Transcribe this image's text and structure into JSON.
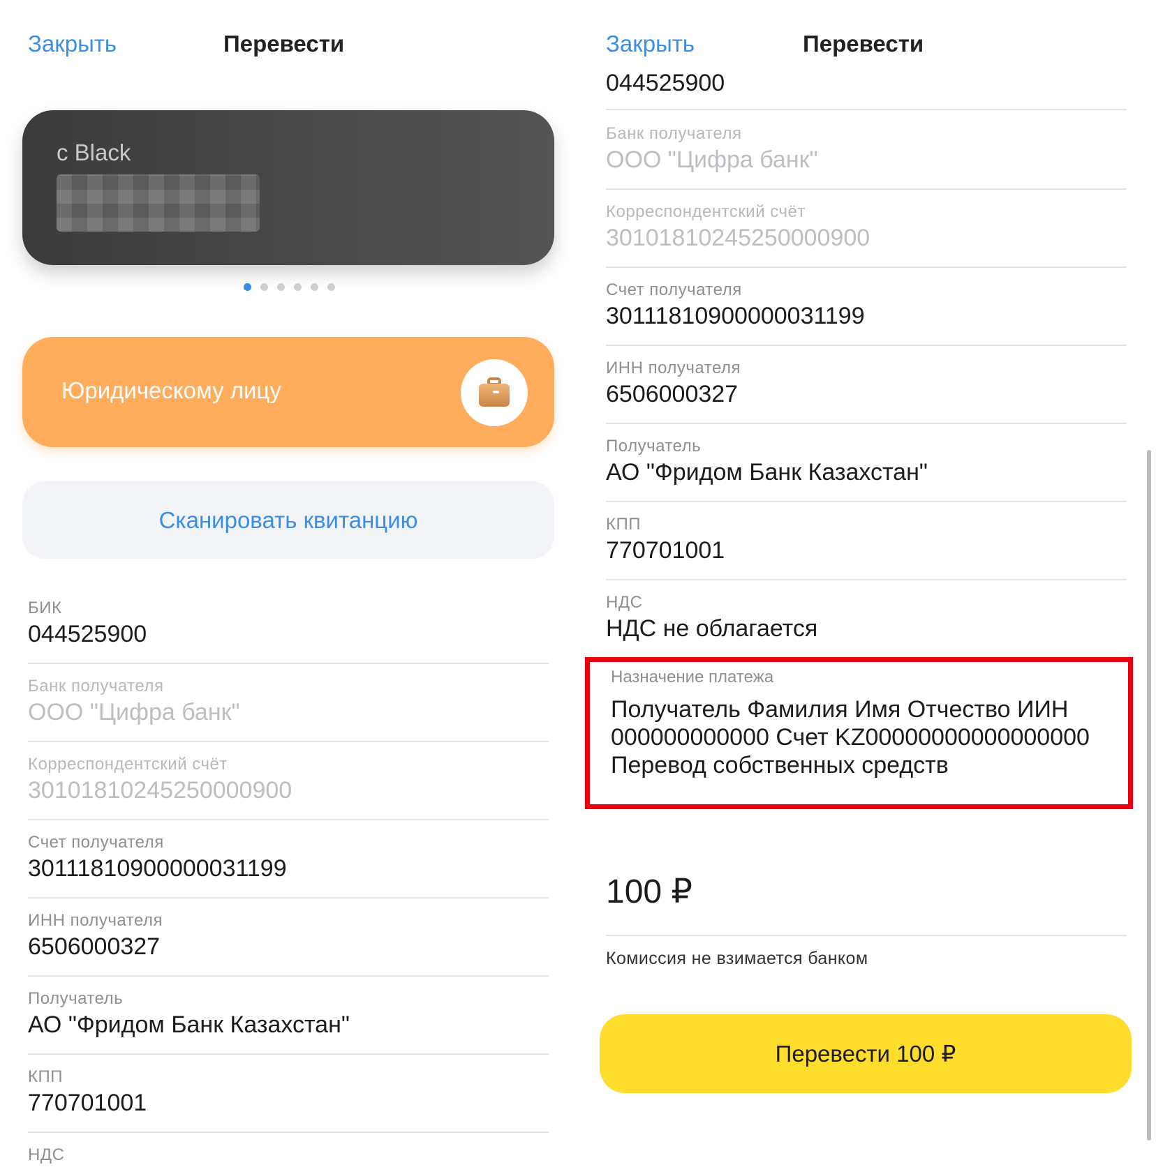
{
  "left": {
    "nav": {
      "close": "Закрыть",
      "title": "Перевести"
    },
    "card": {
      "name": "с Black"
    },
    "legal_entity_button": "Юридическому лицу",
    "scan_button": "Сканировать квитанцию",
    "fields": [
      {
        "label": "БИК",
        "value": "044525900"
      },
      {
        "label": "Банк получателя",
        "value": "ООО \"Цифра банк\""
      },
      {
        "label": "Корреспондентский счёт",
        "value": "30101810245250000900"
      },
      {
        "label": "Счет получателя",
        "value": "30111810900000031199"
      },
      {
        "label": "ИНН получателя",
        "value": "6506000327"
      },
      {
        "label": "Получатель",
        "value": "АО \"Фридом Банк Казахстан\""
      },
      {
        "label": "КПП",
        "value": "770701001"
      },
      {
        "label": "НДС",
        "value": ""
      }
    ]
  },
  "right": {
    "nav": {
      "close": "Закрыть",
      "title": "Перевести"
    },
    "top_partial_value": "044525900",
    "fields": [
      {
        "label": "Банк получателя",
        "value": "ООО \"Цифра банк\""
      },
      {
        "label": "Корреспондентский счёт",
        "value": "30101810245250000900"
      },
      {
        "label": "Счет получателя",
        "value": "30111810900000031199"
      },
      {
        "label": "ИНН получателя",
        "value": "6506000327"
      },
      {
        "label": "Получатель",
        "value": "АО \"Фридом Банк Казахстан\""
      },
      {
        "label": "КПП",
        "value": "770701001"
      },
      {
        "label": "НДС",
        "value": "НДС не облагается"
      }
    ],
    "purpose": {
      "label": "Назначение платежа",
      "value": "Получатель Фамилия Имя Отчество ИИН 000000000000 Счет KZ00000000000000000 Перевод собственных средств"
    },
    "amount": "100 ₽",
    "commission": "Комиссия не взимается банком",
    "pay_button": "Перевести 100 ₽"
  },
  "colors": {
    "accent": "#3a8ee6",
    "legal_button": "#ffad5c",
    "pay_button": "#ffdd2d",
    "highlight": "#e8000f"
  }
}
